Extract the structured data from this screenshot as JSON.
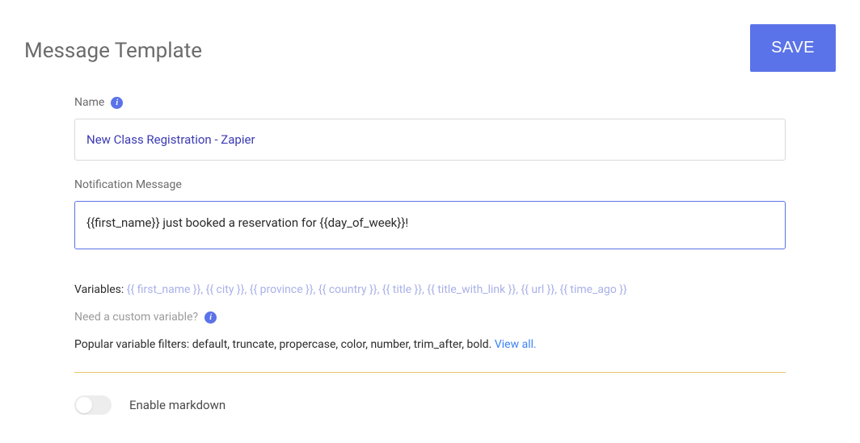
{
  "header": {
    "title": "Message Template",
    "save_label": "SAVE"
  },
  "form": {
    "name_label": "Name",
    "name_value": "New Class Registration - Zapier",
    "message_label": "Notification Message",
    "message_value": "{{first_name}} just booked a reservation for {{day_of_week}}!"
  },
  "variables": {
    "label": "Variables:",
    "tokens": [
      "{{ first_name }}",
      "{{ city }}",
      "{{ province }}",
      "{{ country }}",
      "{{ title }}",
      "{{ title_with_link }}",
      "{{ url }}",
      "{{ time_ago }}"
    ]
  },
  "custom_var": {
    "text": "Need a custom variable?"
  },
  "filters": {
    "prefix": "Popular variable filters: ",
    "list": "default, truncate, propercase, color, number, trim_after, bold.",
    "link": "View all."
  },
  "toggle": {
    "label": "Enable markdown",
    "on": false
  }
}
